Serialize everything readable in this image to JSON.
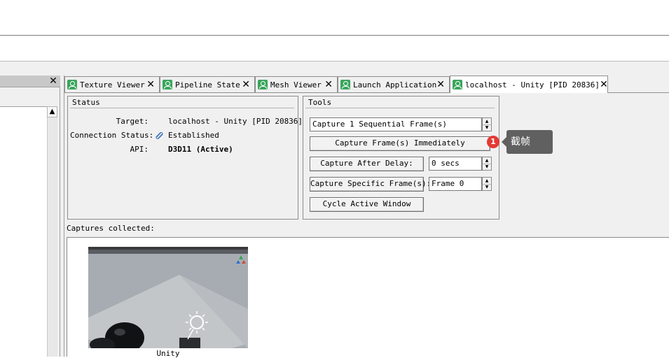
{
  "left_panel": {
    "close_glyph": "✕",
    "scroll_up_glyph": "▲"
  },
  "tabs": [
    {
      "label": "Texture Viewer",
      "close": "✕"
    },
    {
      "label": "Pipeline State",
      "close": "✕"
    },
    {
      "label": "Mesh Viewer",
      "close": "✕"
    },
    {
      "label": "Launch Application",
      "close": "✕"
    },
    {
      "label": "localhost - Unity [PID 20836]",
      "close": "✕"
    }
  ],
  "status": {
    "title": "Status",
    "target_label": "Target:",
    "target_value": "localhost - Unity [PID 20836]",
    "connection_label": "Connection Status:",
    "connection_value": "Established",
    "connection_icon": "connection-link-icon",
    "api_label": "API:",
    "api_value": "D3D11 (Active)"
  },
  "tools": {
    "title": "Tools",
    "sequential_frames": "Capture 1 Sequential Frame(s)",
    "capture_now": "Capture Frame(s) Immediately",
    "capture_after_delay": "Capture After Delay:",
    "delay_value": "0 secs",
    "capture_specific": "Capture Specific Frame(s):",
    "frame_value": "Frame 0",
    "cycle_window": "Cycle Active Window"
  },
  "annotation": {
    "badge": "1",
    "text": "截帧",
    "badge_color": "#e53935"
  },
  "captures": {
    "label": "Captures collected:",
    "items": [
      {
        "caption": "Unity"
      }
    ]
  }
}
